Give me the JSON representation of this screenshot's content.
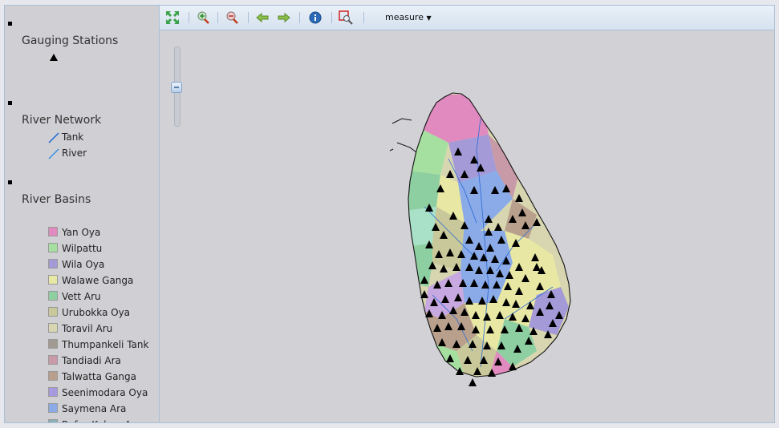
{
  "legend": {
    "gauging": {
      "title": "Gauging Stations"
    },
    "river_network": {
      "title": "River Network",
      "items": [
        {
          "label": "Tank",
          "color": "#1a66d6"
        },
        {
          "label": "River",
          "color": "#3a8ee6"
        }
      ]
    },
    "river_basins": {
      "title": "River Basins",
      "items": [
        {
          "label": "Yan Oya",
          "color": "#e08ac0"
        },
        {
          "label": "Wilpattu",
          "color": "#a6e0a0"
        },
        {
          "label": "Wila Oya",
          "color": "#a49ad8"
        },
        {
          "label": "Walawe Ganga",
          "color": "#e8e8a4"
        },
        {
          "label": "Vett Aru",
          "color": "#8ecfa2"
        },
        {
          "label": "Urubokka Oya",
          "color": "#c8c89a"
        },
        {
          "label": "Toravil Aru",
          "color": "#d8d6b0"
        },
        {
          "label": "Thumpankeli Tank",
          "color": "#a09a90"
        },
        {
          "label": "Tandiadi Ara",
          "color": "#c89aa8"
        },
        {
          "label": "Talwatta Ganga",
          "color": "#b8a08c"
        },
        {
          "label": "Seenimodara Oya",
          "color": "#a89ae0"
        },
        {
          "label": "Saymena Ara",
          "color": "#8aaae8"
        },
        {
          "label": "Rufus Kulam Aru",
          "color": "#8ab0b8"
        }
      ]
    }
  },
  "toolbar": {
    "measure_label": "measure",
    "icons": [
      "zoom-extent-icon",
      "zoom-in-icon",
      "zoom-out-icon",
      "back-arrow-icon",
      "forward-arrow-icon",
      "info-icon",
      "zoom-box-icon"
    ]
  }
}
